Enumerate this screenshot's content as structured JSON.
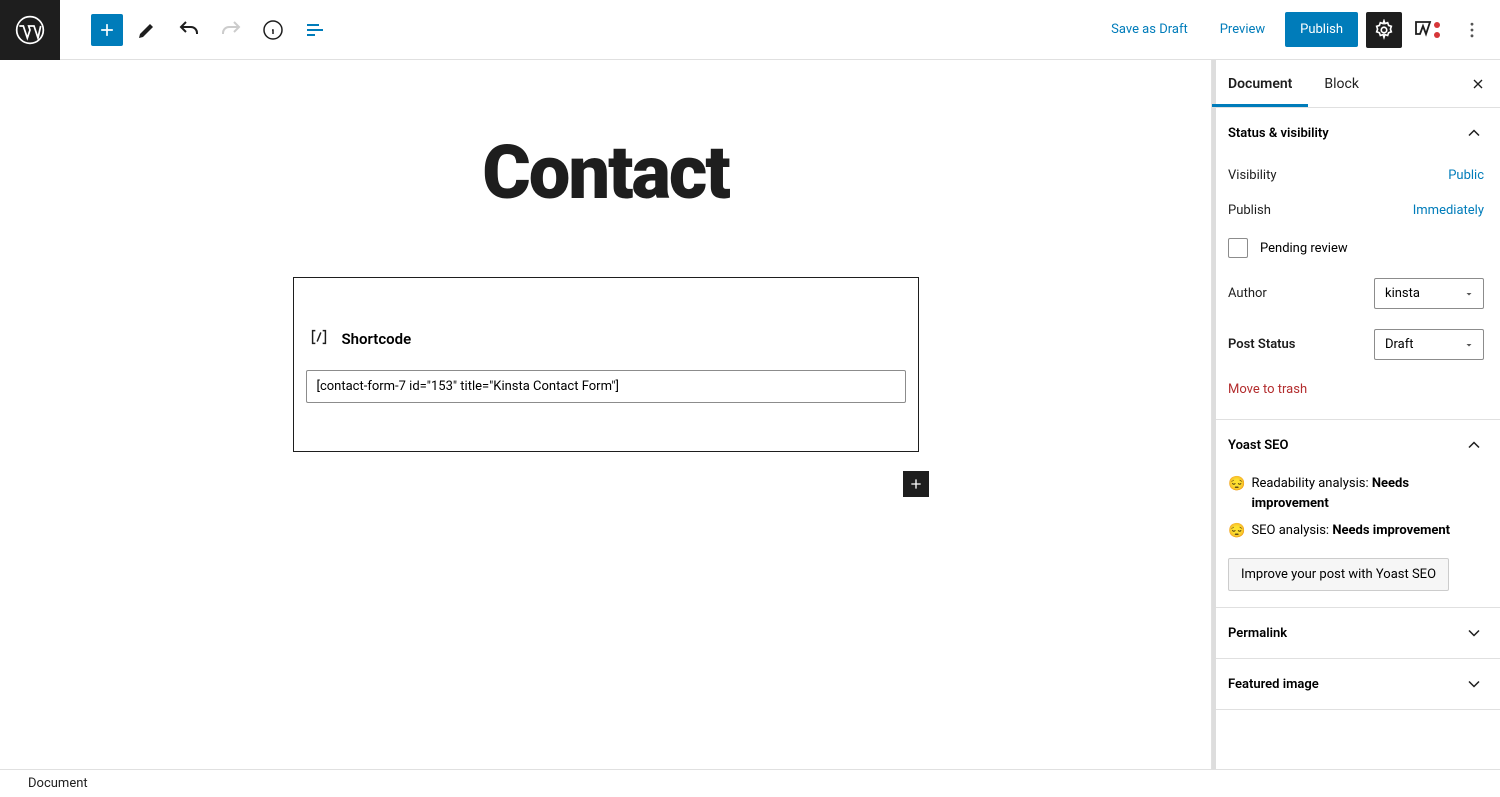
{
  "topbar": {
    "save_draft": "Save as Draft",
    "preview": "Preview",
    "publish": "Publish"
  },
  "editor": {
    "title": "Contact",
    "block_type": "Shortcode",
    "shortcode_value": "[contact-form-7 id=\"153\" title=\"Kinsta Contact Form\"]"
  },
  "sidebar": {
    "tab_document": "Document",
    "tab_block": "Block",
    "status_panel": {
      "title": "Status & visibility",
      "visibility_label": "Visibility",
      "visibility_value": "Public",
      "publish_label": "Publish",
      "publish_value": "Immediately",
      "pending_label": "Pending review",
      "author_label": "Author",
      "author_value": "kinsta",
      "status_label": "Post Status",
      "status_value": "Draft",
      "trash": "Move to trash"
    },
    "yoast_panel": {
      "title": "Yoast SEO",
      "readability_pre": "Readability analysis: ",
      "readability_status": "Needs improvement",
      "seo_pre": "SEO analysis: ",
      "seo_status": "Needs improvement",
      "improve_btn": "Improve your post with Yoast SEO"
    },
    "permalink_panel": "Permalink",
    "featured_panel": "Featured image"
  },
  "footer": {
    "breadcrumb": "Document"
  }
}
